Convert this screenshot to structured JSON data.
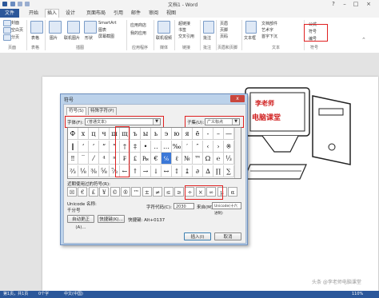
{
  "window": {
    "title": "文档1 - Word"
  },
  "tabs": [
    "文件",
    "开始",
    "插入",
    "设计",
    "页面布局",
    "引用",
    "邮件",
    "审阅",
    "视图"
  ],
  "ribbon": {
    "left": [
      "封面",
      "空白页",
      "分页"
    ],
    "table": "表格",
    "illustrations": [
      "图片",
      "联机图片",
      "形状",
      "SmartArt",
      "图表",
      "屏幕截图"
    ],
    "apps": [
      "应用商店",
      "我的应用"
    ],
    "media": "联机视频",
    "links": [
      "超链接",
      "书签",
      "交叉引用"
    ],
    "comment": "批注",
    "headerfooter": [
      "页眉",
      "页脚",
      "页码"
    ],
    "text": [
      "文本框",
      "文档部件",
      "艺术字",
      "首字下沉"
    ],
    "symbols": [
      "公式",
      "符号",
      "编号"
    ],
    "groups": [
      "页面",
      "表格",
      "插图",
      "应用程序",
      "媒体",
      "链接",
      "批注",
      "页眉和页脚",
      "文本",
      "符号"
    ]
  },
  "dialog": {
    "title": "符号",
    "close": "x",
    "tabs": [
      "符号(S)",
      "特殊字符(P)"
    ],
    "font_label": "字体(F):",
    "font_value": "(普通文本)",
    "subset_label": "子集(U):",
    "subset_value": "广义标点",
    "grid_rows": [
      [
        "Ф",
        "х",
        "ц",
        "ч",
        "ш",
        "щ",
        "ъ",
        "ы",
        "ь",
        "э",
        "ю",
        "я",
        "ё",
        "‐",
        "–",
        "—"
      ],
      [
        "‖",
        "‘",
        "’",
        "“",
        "”",
        "†",
        "‡",
        "•",
        "‥",
        "…",
        "‰",
        "′",
        "″",
        "‹",
        "›",
        "※"
      ],
      [
        "‼",
        "‾",
        "⁄",
        "⁴",
        "ⁿ",
        "₣",
        "₤",
        "₧",
        "€",
        "℅",
        "ℓ",
        "№",
        "™",
        "Ω",
        "℮",
        "⅓"
      ],
      [
        "⅔",
        "⅛",
        "⅜",
        "⅝",
        "⅞",
        "←",
        "↑",
        "→",
        "↓",
        "↔",
        "↕",
        "↨",
        "∂",
        "∆",
        "∏",
        "∑"
      ]
    ],
    "selected_char": "℅",
    "recent_label": "近期使用过的符号(R):",
    "recent": [
      "☒",
      "€",
      "£",
      "¥",
      "©",
      "®",
      "™",
      "±",
      "≠",
      "≤",
      "≥",
      "÷",
      "×",
      "∞",
      "µ",
      "α"
    ],
    "unicode_name_label": "Unicode 名称:",
    "unicode_name_value": "千分号",
    "charcode_label": "字符代码(C):",
    "charcode_value": "2030",
    "from_label": "来自(M):",
    "from_value": "Unicode(十六进制)",
    "autocorrect": "自动更正(A)...",
    "shortcut_key": "快捷键(K)...",
    "shortcut_text": "快捷键: Alt+0137",
    "insert": "插入(I)",
    "cancel": "取消"
  },
  "logo": {
    "line1": "李老师",
    "line2": "电脑课堂"
  },
  "statusbar": {
    "page": "第1页，共1页",
    "words": "0个字",
    "lang": "中文(中国)",
    "zoom": "110%"
  },
  "watermark": "头条 @李老师电脑课堂",
  "accent": "#2b579a",
  "highlight": "#e02020"
}
